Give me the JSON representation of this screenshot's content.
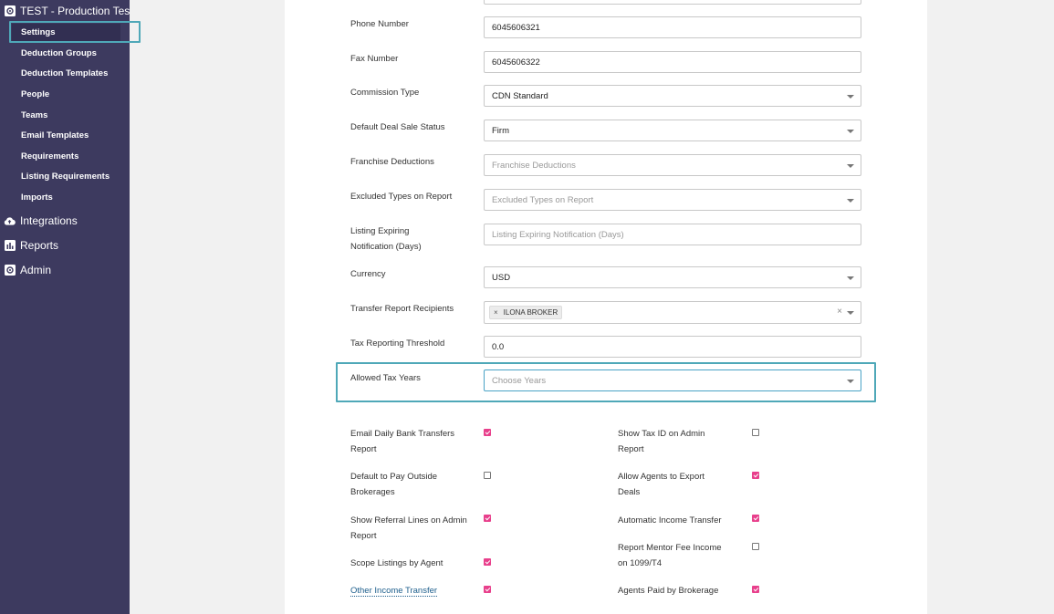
{
  "sidebar": {
    "org_title": "TEST - Production Tes",
    "items": [
      {
        "label": "Settings",
        "active": true
      },
      {
        "label": "Deduction Groups"
      },
      {
        "label": "Deduction Templates"
      },
      {
        "label": "People"
      },
      {
        "label": "Teams"
      },
      {
        "label": "Email Templates"
      },
      {
        "label": "Requirements"
      },
      {
        "label": "Listing Requirements"
      },
      {
        "label": "Imports"
      }
    ],
    "sections": [
      {
        "label": "Integrations",
        "icon": "cloud-upload-icon"
      },
      {
        "label": "Reports",
        "icon": "bar-chart-icon"
      },
      {
        "label": "Admin",
        "icon": "gear-icon"
      }
    ]
  },
  "form": {
    "phone": {
      "label": "Phone Number",
      "value": "6045606321"
    },
    "fax": {
      "label": "Fax Number",
      "value": "6045606322"
    },
    "commission_type": {
      "label": "Commission Type",
      "value": "CDN Standard"
    },
    "deal_status": {
      "label": "Default Deal Sale Status",
      "value": "Firm"
    },
    "franchise_deductions": {
      "label": "Franchise Deductions",
      "placeholder": "Franchise Deductions"
    },
    "excluded_types": {
      "label": "Excluded Types on Report",
      "placeholder": "Excluded Types on Report"
    },
    "listing_expiring": {
      "label": "Listing Expiring Notification (Days)",
      "placeholder": "Listing Expiring Notification (Days)"
    },
    "currency": {
      "label": "Currency",
      "value": "USD"
    },
    "transfer_recipients": {
      "label": "Transfer Report Recipients",
      "tag": "ILONA BROKER",
      "tag_remove": "×",
      "clear": "×"
    },
    "tax_threshold": {
      "label": "Tax Reporting Threshold",
      "value": "0.0"
    },
    "allowed_tax_years": {
      "label": "Allowed Tax Years",
      "placeholder": "Choose Years"
    }
  },
  "checkboxes": {
    "left": [
      {
        "label": "Email Daily Bank Transfers Report",
        "checked": true
      },
      {
        "label": "Default to Pay Outside Brokerages",
        "checked": false
      },
      {
        "label": "Show Referral Lines on Admin Report",
        "checked": true
      },
      {
        "label": "Scope Listings by Agent",
        "checked": true
      },
      {
        "label": "Other Income Transfer",
        "checked": true
      }
    ],
    "right": [
      {
        "label": "Show Tax ID on Admin Report",
        "checked": false
      },
      {
        "label": "Allow Agents to Export Deals",
        "checked": true
      },
      {
        "label": "Automatic Income Transfer",
        "checked": true
      },
      {
        "label": "Report Mentor Fee Income on 1099/T4",
        "checked": false
      },
      {
        "label": "Agents Paid by Brokerage",
        "checked": true
      }
    ]
  },
  "colors": {
    "sidebar": "#3d3a5f",
    "highlight": "#4fa8b8",
    "checkbox_on": "#e8408c"
  }
}
